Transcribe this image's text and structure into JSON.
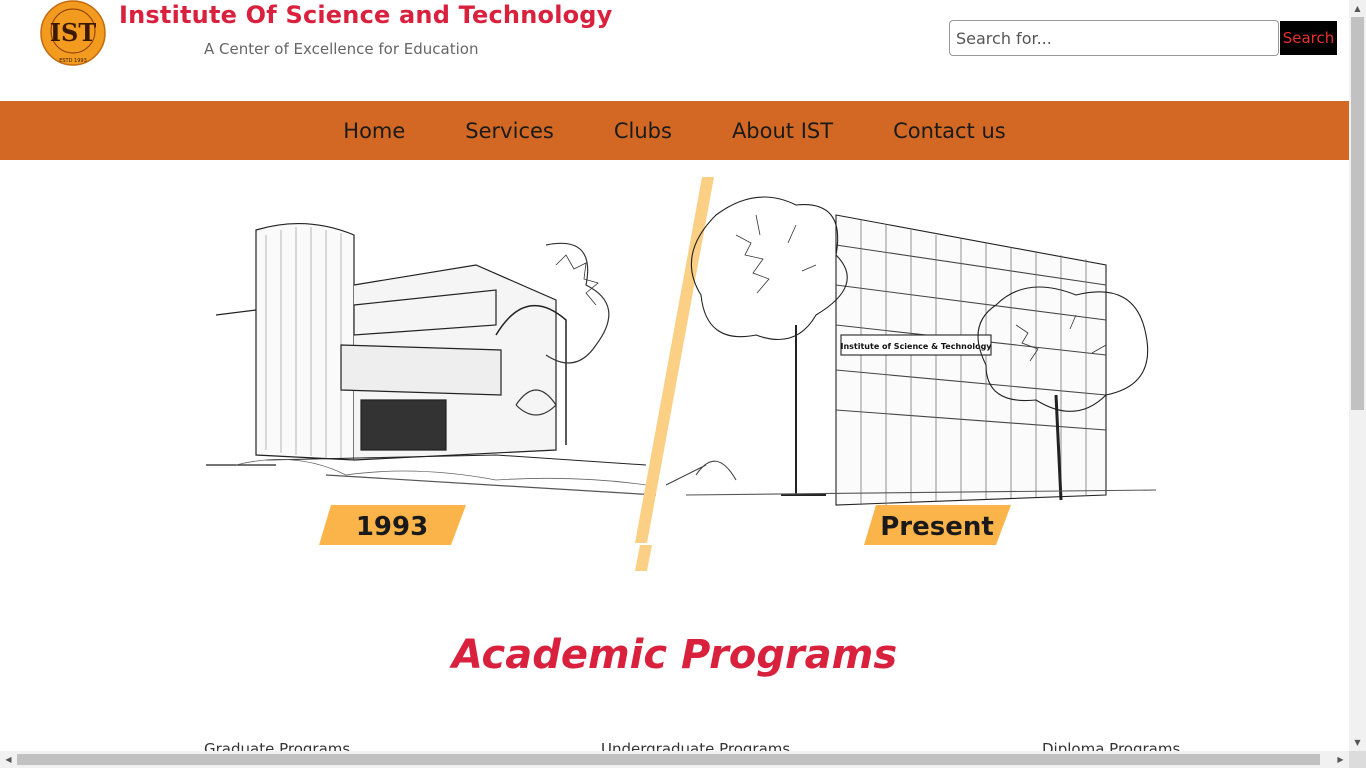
{
  "header": {
    "logo_text": "IST",
    "logo_ring_text": "Institute of Science & Technology",
    "logo_estd": "ESTD 1993",
    "title": "Institute Of Science and Technology",
    "tagline": "A Center of Excellence for Education",
    "search_placeholder": "Search for...",
    "search_label": "Search"
  },
  "nav": {
    "items": [
      "Home",
      "Services",
      "Clubs",
      "About IST",
      "Contact us"
    ]
  },
  "hero": {
    "left_year": "1993",
    "right_year": "Present",
    "building_sign": "Institute of Science & Technology"
  },
  "academics": {
    "title": "Academic Programs",
    "programs": [
      "Graduate Programs",
      "Undergraduate Programs",
      "Diploma Programs"
    ]
  },
  "colors": {
    "brand_red": "#d9213d",
    "nav_orange": "#d26823",
    "accent_yellow": "#fbb44a"
  },
  "icons": {
    "logo": "ist-logo-icon"
  }
}
